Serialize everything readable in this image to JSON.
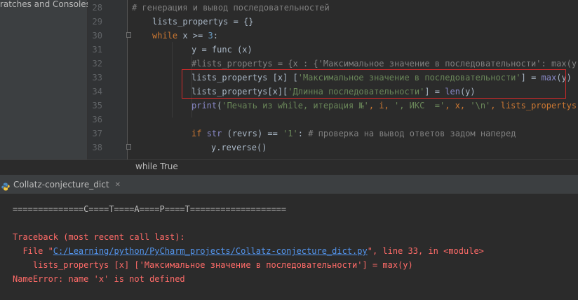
{
  "project_panel": {
    "label": "ratches and Consoles"
  },
  "editor": {
    "line_numbers": [
      "28",
      "29",
      "30",
      "31",
      "32",
      "33",
      "34",
      "35",
      "36",
      "37",
      "38"
    ],
    "lines": [
      {
        "segments": [
          {
            "text": "# генерация и вывод последовательностей",
            "color": "#808080"
          }
        ]
      },
      {
        "segments": [
          {
            "text": "lists_propertys",
            "color": "#a9b7c6"
          },
          {
            "text": " = {}",
            "color": "#a9b7c6"
          }
        ]
      },
      {
        "segments": [
          {
            "text": "while",
            "color": "#cc7832"
          },
          {
            "text": " x >= ",
            "color": "#a9b7c6"
          },
          {
            "text": "3",
            "color": "#6897bb"
          },
          {
            "text": ":",
            "color": "#a9b7c6"
          }
        ]
      },
      {
        "segments": [
          {
            "text": "y = func",
            "color": "#a9b7c6"
          },
          {
            "text": " ",
            "color": "#a9b7c6"
          },
          {
            "text": "(x)",
            "color": "#a9b7c6"
          }
        ]
      },
      {
        "segments": [
          {
            "text": "#lists_propertys = {x : {'Максимальное значение в последовательности': max(y),'",
            "color": "#808080"
          }
        ]
      },
      {
        "segments": [
          {
            "text": "lists_propertys",
            "color": "#a9b7c6"
          },
          {
            "text": " [x] [",
            "color": "#a9b7c6"
          },
          {
            "text": "'Максимальное значение в последовательности'",
            "color": "#6a8759"
          },
          {
            "text": "] = ",
            "color": "#a9b7c6"
          },
          {
            "text": "max",
            "color": "#8888c6"
          },
          {
            "text": "(y)",
            "color": "#a9b7c6"
          }
        ]
      },
      {
        "segments": [
          {
            "text": "lists_propertys[x][",
            "color": "#a9b7c6"
          },
          {
            "text": "'Длинна последовательности'",
            "color": "#6a8759"
          },
          {
            "text": "] = ",
            "color": "#a9b7c6"
          },
          {
            "text": "len",
            "color": "#8888c6"
          },
          {
            "text": "(y)",
            "color": "#a9b7c6"
          }
        ]
      },
      {
        "segments": [
          {
            "text": "print",
            "color": "#8888c6"
          },
          {
            "text": "(",
            "color": "#a9b7c6"
          },
          {
            "text": "'Печать из while, итерация №'",
            "color": "#6a8759"
          },
          {
            "text": ", i, ",
            "color": "#cc7832"
          },
          {
            "text": "', ИКС  ='",
            "color": "#6a8759"
          },
          {
            "text": ", x, ",
            "color": "#cc7832"
          },
          {
            "text": "'\\n'",
            "color": "#6a8759"
          },
          {
            "text": ", lists_propertys, '",
            "color": "#cc7832"
          }
        ]
      },
      {
        "segments": []
      },
      {
        "segments": [
          {
            "text": "if",
            "color": "#cc7832"
          },
          {
            "text": " ",
            "color": "#a9b7c6"
          },
          {
            "text": "str",
            "color": "#8888c6"
          },
          {
            "text": " (revrs) == ",
            "color": "#a9b7c6"
          },
          {
            "text": "'1'",
            "color": "#6a8759"
          },
          {
            "text": ":",
            "color": "#a9b7c6"
          },
          {
            "text": " # проверка на вывод ответов задом наперед",
            "color": "#808080"
          }
        ]
      },
      {
        "segments": [
          {
            "text": "y.reverse()",
            "color": "#a9b7c6"
          }
        ]
      }
    ]
  },
  "breadcrumb": "while True",
  "run_panel": {
    "tab_label": "Collatz-conjecture_dict",
    "close_symbol": "✕"
  },
  "console": {
    "separator_line": "==============C====T====A====P====T===================",
    "traceback_header": "Traceback (most recent call last):",
    "file_prefix": "  File \"",
    "file_path": "C:/Learning/python/PyCharm_projects/Collatz-conjecture_dict.py",
    "file_suffix": "\", line 33, in <module>",
    "error_code_line": "    lists_propertys [x] ['Максимальное значение в последовательности'] = max(y)",
    "error_message": "NameError: name 'x' is not defined"
  },
  "colors": {
    "error_text": "#ff6b68",
    "stdout_text": "#bbbbbb",
    "link": "#5394ec",
    "error_box": "#d02a2a"
  }
}
